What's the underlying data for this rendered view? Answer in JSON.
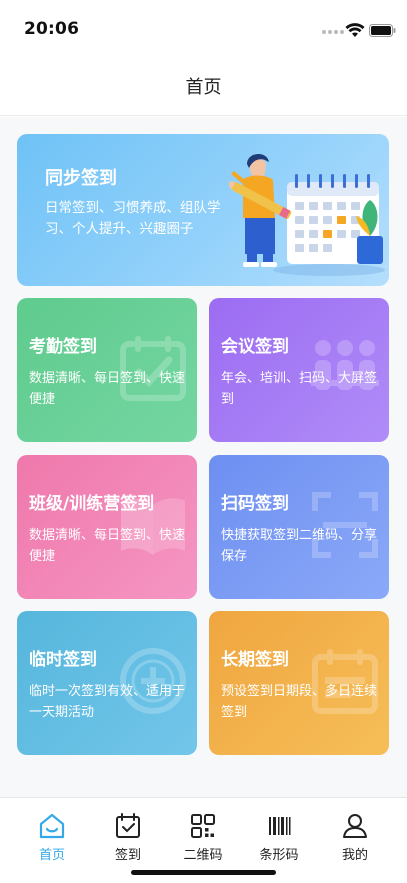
{
  "status": {
    "time": "20:06"
  },
  "nav": {
    "title": "首页"
  },
  "hero": {
    "title": "同步签到",
    "desc": "日常签到、习惯养成、组队学习、个人提升、兴趣圈子"
  },
  "cards": [
    {
      "title": "考勤签到",
      "desc": "数据清晰、每日签到、快速便捷",
      "color": "#5fcb8d",
      "icon": "calendar-check-icon"
    },
    {
      "title": "会议签到",
      "desc": "年会、培训、扫码、大屏签到",
      "color": "#9c6cf2",
      "icon": "meeting-people-icon"
    },
    {
      "title": "班级/训练营签到",
      "desc": "数据清晰、每日签到、快速便捷",
      "color": "#ef78ab",
      "icon": "open-book-icon"
    },
    {
      "title": "扫码签到",
      "desc": "快捷获取签到二维码、分享保存",
      "color": "#6d8ff1",
      "icon": "scan-frame-icon"
    },
    {
      "title": "临时签到",
      "desc": "临时一次签到有效、适用于一天期活动",
      "color": "#56b6dc",
      "icon": "temporary-stamp-icon"
    },
    {
      "title": "长期签到",
      "desc": "预设签到日期段、多日连续签到",
      "color": "#f0a640",
      "icon": "calendar-range-icon"
    }
  ],
  "tabs": [
    {
      "label": "首页",
      "icon": "home-icon",
      "active": true
    },
    {
      "label": "签到",
      "icon": "calendar-check-icon",
      "active": false
    },
    {
      "label": "二维码",
      "icon": "qrcode-icon",
      "active": false
    },
    {
      "label": "条形码",
      "icon": "barcode-icon",
      "active": false
    },
    {
      "label": "我的",
      "icon": "user-icon",
      "active": false
    }
  ],
  "colors": {
    "accent": "#35a9e7",
    "tab_inactive": "#222222"
  }
}
